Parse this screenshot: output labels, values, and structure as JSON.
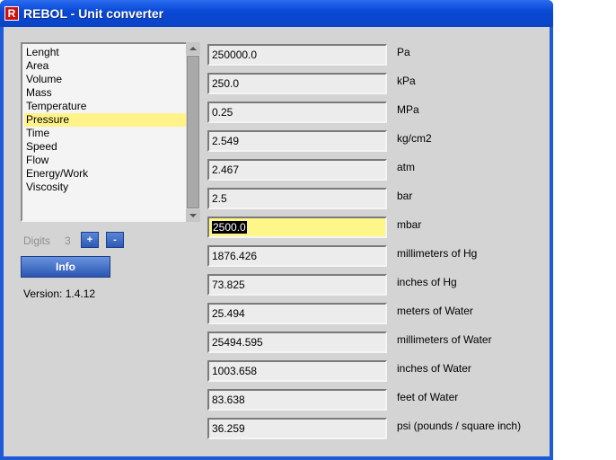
{
  "window": {
    "title": "REBOL - Unit converter",
    "icon_letter": "R"
  },
  "categories": [
    "Lenght",
    "Area",
    "Volume",
    "Mass",
    "Temperature",
    "Pressure",
    "Time",
    "Speed",
    "Flow",
    "Energy/Work",
    "Viscosity"
  ],
  "selected_category": "Pressure",
  "digits": {
    "label": "Digits",
    "value": "3",
    "plus_label": "+",
    "minus_label": "-"
  },
  "info_button": "Info",
  "version": "Version: 1.4.12",
  "conversions": [
    {
      "value": "250000.0",
      "unit": "Pa"
    },
    {
      "value": "250.0",
      "unit": "kPa"
    },
    {
      "value": "0.25",
      "unit": "MPa"
    },
    {
      "value": "2.549",
      "unit": "kg/cm2"
    },
    {
      "value": "2.467",
      "unit": "atm"
    },
    {
      "value": "2.5",
      "unit": "bar"
    },
    {
      "value": "2500.0",
      "unit": "mbar",
      "active": true
    },
    {
      "value": "1876.426",
      "unit": "millimeters of Hg"
    },
    {
      "value": "73.825",
      "unit": "inches of Hg"
    },
    {
      "value": "25.494",
      "unit": "meters of Water"
    },
    {
      "value": "25494.595",
      "unit": "millimeters of Water"
    },
    {
      "value": "1003.658",
      "unit": "inches of Water"
    },
    {
      "value": "83.638",
      "unit": "feet of Water"
    },
    {
      "value": "36.259",
      "unit": "psi (pounds / square inch)"
    }
  ],
  "colors": {
    "titlebar": "#0a4ad6",
    "selection": "#fff38a",
    "active_field": "#fff68a",
    "button": "#2d59b4"
  }
}
